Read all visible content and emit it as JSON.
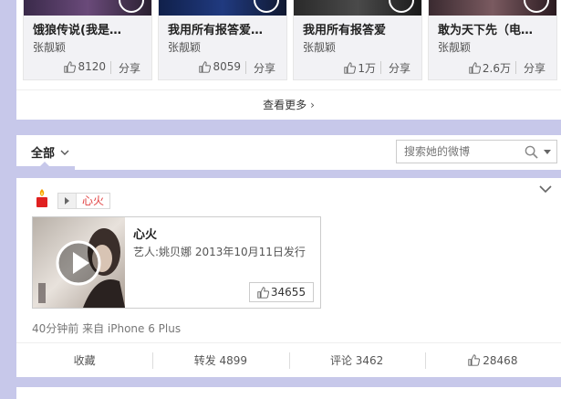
{
  "cards": [
    {
      "title": "饿狼传说(我是…",
      "author": "张靓颖",
      "likes": "8120",
      "share": "分享"
    },
    {
      "title": "我用所有报答爱…",
      "author": "张靓颖",
      "likes": "8059",
      "share": "分享"
    },
    {
      "title": "我用所有报答爱",
      "author": "张靓颖",
      "likes": "1万",
      "share": "分享"
    },
    {
      "title": "敢为天下先（电…",
      "author": "张靓颖",
      "likes": "2.6万",
      "share": "分享"
    }
  ],
  "see_more": "查看更多",
  "filter": {
    "tab_all": "全部",
    "search_placeholder": "搜索她的微博"
  },
  "post": {
    "tag_label": "心火",
    "media_title": "心火",
    "media_artist": "艺人:姚贝娜 2013年10月11日发行",
    "media_likes": "34655",
    "meta": "40分钟前 来自 iPhone 6 Plus",
    "actions": {
      "favorite": "收藏",
      "repost": "转发 4899",
      "comment": "评论 3462",
      "like": "28468"
    }
  },
  "colors": {
    "page_bg": "#c7c8ea",
    "accent_red": "#e03c3c"
  }
}
